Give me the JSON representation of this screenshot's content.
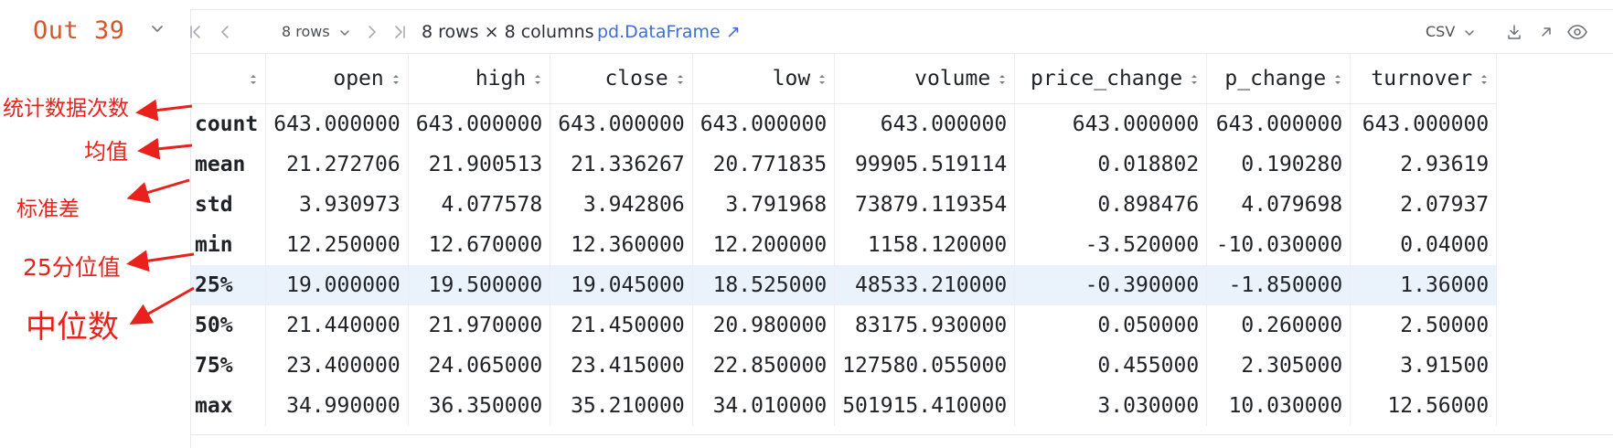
{
  "cell_header": {
    "out_label": "Out 39"
  },
  "toolbar": {
    "rows_selector": "8 rows",
    "dimensions": "8 rows × 8 columns",
    "type_link": "pd.DataFrame ↗",
    "export_format": "CSV"
  },
  "table": {
    "columns": [
      "open",
      "high",
      "close",
      "low",
      "volume",
      "price_change",
      "p_change",
      "turnover"
    ],
    "rows": [
      {
        "index": "count",
        "values": [
          "643.000000",
          "643.000000",
          "643.000000",
          "643.000000",
          "643.000000",
          "643.000000",
          "643.000000",
          "643.000000"
        ]
      },
      {
        "index": "mean",
        "values": [
          "21.272706",
          "21.900513",
          "21.336267",
          "20.771835",
          "99905.519114",
          "0.018802",
          "0.190280",
          "2.93619"
        ]
      },
      {
        "index": "std",
        "values": [
          "3.930973",
          "4.077578",
          "3.942806",
          "3.791968",
          "73879.119354",
          "0.898476",
          "4.079698",
          "2.07937"
        ]
      },
      {
        "index": "min",
        "values": [
          "12.250000",
          "12.670000",
          "12.360000",
          "12.200000",
          "1158.120000",
          "-3.520000",
          "-10.030000",
          "0.04000"
        ]
      },
      {
        "index": "25%",
        "values": [
          "19.000000",
          "19.500000",
          "19.045000",
          "18.525000",
          "48533.210000",
          "-0.390000",
          "-1.850000",
          "1.36000"
        ]
      },
      {
        "index": "50%",
        "values": [
          "21.440000",
          "21.970000",
          "21.450000",
          "20.980000",
          "83175.930000",
          "0.050000",
          "0.260000",
          "2.50000"
        ]
      },
      {
        "index": "75%",
        "values": [
          "23.400000",
          "24.065000",
          "23.415000",
          "22.850000",
          "127580.055000",
          "0.455000",
          "2.305000",
          "3.91500"
        ]
      },
      {
        "index": "max",
        "values": [
          "34.990000",
          "36.350000",
          "35.210000",
          "34.010000",
          "501915.410000",
          "3.030000",
          "10.030000",
          "12.56000"
        ]
      }
    ],
    "highlighted_row_index": 4
  },
  "annotations": {
    "count": "统计数据次数",
    "mean": "均值",
    "std": "标准差",
    "p25": "25分位值",
    "median": "中位数"
  },
  "colors": {
    "annotation": "#e8211c",
    "out_label": "#d2572c",
    "link": "#3b6fd6",
    "highlight_row": "#eaf2fc"
  },
  "icons": [
    "chevron-down-icon",
    "first-page-icon",
    "prev-page-icon",
    "next-page-icon",
    "last-page-icon",
    "sort-icon",
    "download-icon",
    "open-external-icon",
    "eye-icon"
  ]
}
